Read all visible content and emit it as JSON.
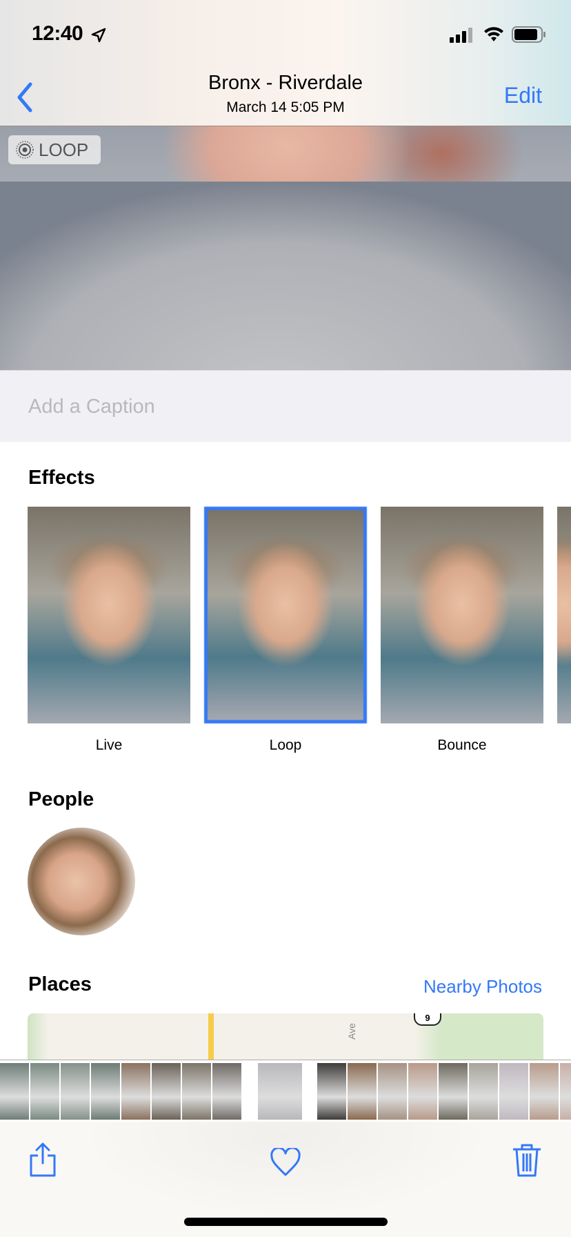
{
  "status_bar": {
    "time": "12:40",
    "icons": [
      "location-arrow-icon",
      "cellular-signal-icon",
      "wifi-icon",
      "battery-icon"
    ]
  },
  "nav": {
    "title": "Bronx - Riverdale",
    "subtitle": "March 14  5:05 PM",
    "edit_label": "Edit",
    "back_icon": "chevron-left-icon"
  },
  "photo": {
    "badge": "LOOP"
  },
  "caption": {
    "placeholder": "Add a Caption"
  },
  "effects": {
    "heading": "Effects",
    "items": [
      {
        "label": "Live",
        "selected": false
      },
      {
        "label": "Loop",
        "selected": true
      },
      {
        "label": "Bounce",
        "selected": false
      }
    ]
  },
  "people": {
    "heading": "People"
  },
  "places": {
    "heading": "Places",
    "nearby_label": "Nearby Photos",
    "map_label": "Ave",
    "route_shield": "9"
  },
  "toolbar": {
    "icons": [
      "share-icon",
      "heart-icon",
      "trash-icon"
    ]
  },
  "colors": {
    "accent": "#3478f6"
  }
}
